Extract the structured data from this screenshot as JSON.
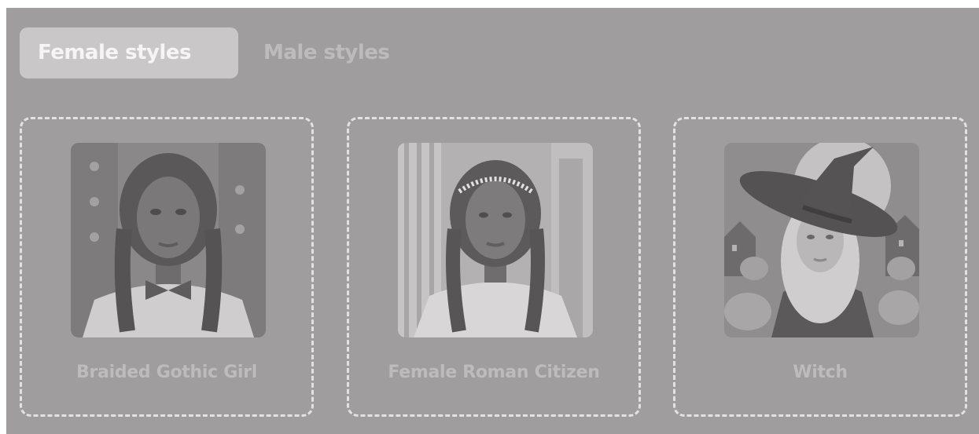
{
  "tabs": [
    {
      "label": "Female styles",
      "active": true
    },
    {
      "label": "Male styles",
      "active": false
    }
  ],
  "styles": [
    {
      "label": "Braided Gothic Girl",
      "image": "portrait-braided-gothic-girl"
    },
    {
      "label": "Female Roman Citizen",
      "image": "portrait-female-roman-citizen"
    },
    {
      "label": "Witch",
      "image": "portrait-witch"
    }
  ],
  "colors": {
    "overlay": "#9f9d9e",
    "active_tab_bg": "#c9c7c8",
    "active_tab_text": "#f6f5f5",
    "muted_text": "#bdbbbc",
    "card_border": "#e3e1e2"
  }
}
